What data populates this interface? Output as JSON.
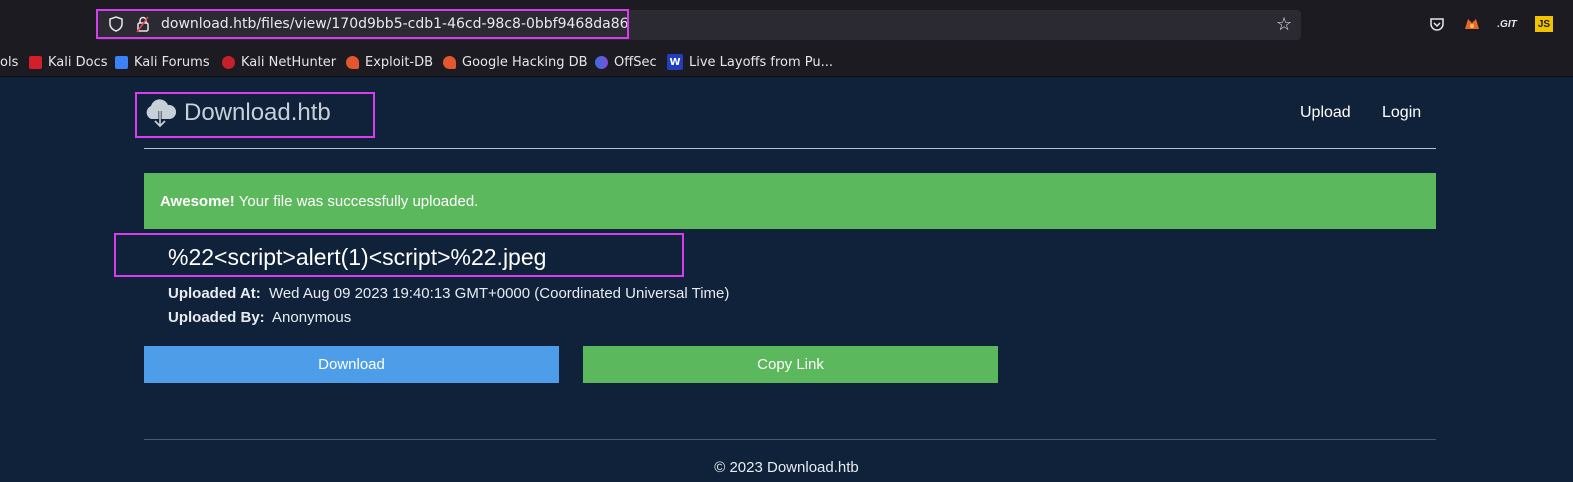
{
  "browser": {
    "url": "download.htb/files/view/170d9bb5-cdb1-46cd-98c8-0bbf9468da86",
    "bookmarks": [
      {
        "label": "ols"
      },
      {
        "label": "Kali Docs"
      },
      {
        "label": "Kali Forums"
      },
      {
        "label": "Kali NetHunter"
      },
      {
        "label": "Exploit-DB"
      },
      {
        "label": "Google Hacking DB"
      },
      {
        "label": "OffSec"
      },
      {
        "label": "Live Layoffs from Pu..."
      }
    ],
    "extensions": [
      {
        "name": "pocket-icon"
      },
      {
        "name": "fox-extension-icon"
      },
      {
        "name": "git-extension-icon",
        "label": ".GIT"
      },
      {
        "name": "js-extension-icon",
        "label": "JS"
      }
    ]
  },
  "site": {
    "logo_text": "Download.htb",
    "nav": {
      "upload": "Upload",
      "login": "Login"
    },
    "alert": {
      "strong": "Awesome!",
      "text": "Your file was successfully uploaded."
    },
    "file": {
      "name": "%22<script>alert(1)<script>%22.jpeg",
      "uploaded_at_label": "Uploaded At:",
      "uploaded_at_value": "Wed Aug 09 2023 19:40:13 GMT+0000 (Coordinated Universal Time)",
      "uploaded_by_label": "Uploaded By:",
      "uploaded_by_value": "Anonymous"
    },
    "buttons": {
      "download": "Download",
      "copy_link": "Copy Link"
    },
    "footer": "© 2023 Download.htb"
  },
  "colors": {
    "page_bg": "#0f2239",
    "alert_green": "#5cb85c",
    "download_blue": "#4d9de8",
    "copy_green": "#5cb85c",
    "highlight_magenta": "#d83cf0"
  }
}
